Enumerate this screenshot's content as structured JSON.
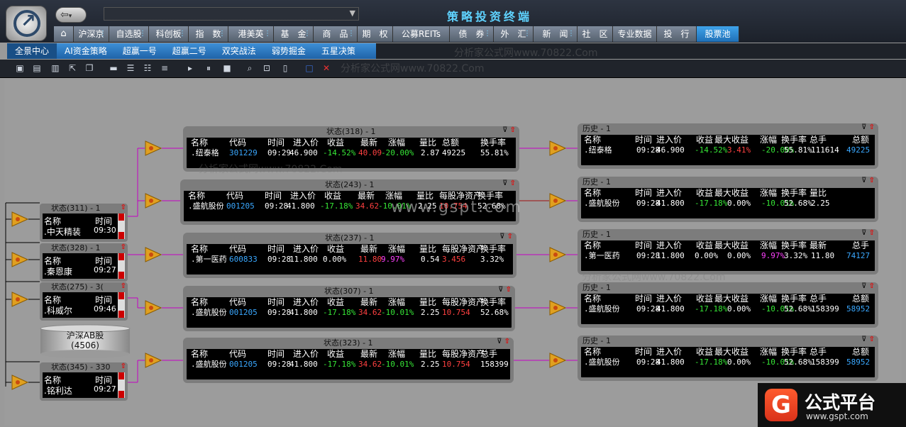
{
  "header": {
    "title": "策略投资终端",
    "address": ""
  },
  "nav": {
    "home_icon": "home-icon",
    "items": [
      {
        "label": "沪深京",
        "more": true
      },
      {
        "label": "自选股",
        "more": true
      },
      {
        "label": "科创板",
        "more": true
      },
      {
        "label": "指　数",
        "more": true
      },
      {
        "label": "港美英",
        "more": true
      },
      {
        "label": "基　金",
        "more": true
      },
      {
        "label": "商　品",
        "more": true
      },
      {
        "label": "期　权",
        "more": false
      },
      {
        "label": "公募REITs",
        "more": false
      },
      {
        "label": "债　券",
        "more": true
      },
      {
        "label": "外　汇",
        "more": true
      },
      {
        "label": "新　闻",
        "more": true
      },
      {
        "label": "社　区",
        "more": false
      },
      {
        "label": "专业数据",
        "more": false
      },
      {
        "label": "投　行",
        "more": false
      },
      {
        "label": "股票池",
        "more": false
      }
    ],
    "more_glyph": "⋮"
  },
  "subnav": {
    "items": [
      "全景中心",
      "AI资金策略",
      "超赢一号",
      "超赢二号",
      "双突战法",
      "弱势掘金",
      "五星决策"
    ]
  },
  "toolbar_icons": [
    "new-folder-icon",
    "open-folder-icon",
    "save-icon",
    "export-icon",
    "window-icon",
    "bar-flat-icon",
    "bar-align-top-icon",
    "bar-align-bottom-icon",
    "bar-color-icon",
    "step-icon",
    "pause-icon",
    "stop-icon",
    "zoom-icon",
    "fit-icon",
    "delete-doc-icon",
    "frame-icon",
    "close-icon"
  ],
  "left_panels": [
    {
      "title": "状态(311) - 1",
      "h1": "名称",
      "h2": "时间",
      "name": ".中天精装",
      "time": "09:30"
    },
    {
      "title": "状态(328) - 1",
      "h1": "名称",
      "h2": "时间",
      "name": ".秦恩康",
      "time": "09:27"
    },
    {
      "title": "状态(275) - 3(",
      "h1": "名称",
      "h2": "时间",
      "name": ".科威尔",
      "time": "09:46"
    },
    {
      "title": "状态(345) - 330",
      "h1": "名称",
      "h2": "时间",
      "name": ".铭利达",
      "time": "09:27"
    }
  ],
  "database": {
    "line1": "沪深AB股",
    "line2": "(4506)"
  },
  "mid_panels": [
    {
      "title": "状态(318) - 1",
      "headers": [
        "名称",
        "代码",
        "时间",
        "进入价",
        "收益",
        "最新",
        "涨幅",
        "量比",
        "总额",
        "换手率"
      ],
      "row": [
        ".纽泰格",
        "301229",
        "09:29",
        "46.900",
        "-14.52%",
        "40.09",
        "-20.00%",
        "2.87",
        "49225",
        "55.81%"
      ]
    },
    {
      "title": "状态(243) - 1",
      "headers": [
        "名称",
        "代码",
        "时间",
        "进入价",
        "收益",
        "最新",
        "涨幅",
        "量比",
        "每股净资产",
        "换手率"
      ],
      "row": [
        ".盛航股份",
        "001205",
        "09:28",
        "41.800",
        "-17.18%",
        "34.62",
        "-10.01%",
        "2.25",
        "10.754",
        "52.68%"
      ]
    },
    {
      "title": "状态(237) - 1",
      "headers": [
        "名称",
        "代码",
        "时间",
        "进入价",
        "收益",
        "最新",
        "涨幅",
        "量比",
        "每股净资产",
        "换手率"
      ],
      "row": [
        ".第一医药",
        "600833",
        "09:28",
        "11.800",
        "0.00%",
        "11.80",
        "9.97%",
        "0.54",
        "3.456",
        "3.32%"
      ]
    },
    {
      "title": "状态(307) - 1",
      "headers": [
        "名称",
        "代码",
        "时间",
        "进入价",
        "收益",
        "最新",
        "涨幅",
        "量比",
        "每股净资产",
        "换手率"
      ],
      "row": [
        ".盛航股份",
        "001205",
        "09:28",
        "41.800",
        "-17.18%",
        "34.62",
        "-10.01%",
        "2.25",
        "10.754",
        "52.68%"
      ]
    },
    {
      "title": "状态(323) - 1",
      "headers": [
        "名称",
        "代码",
        "时间",
        "进入价",
        "收益",
        "最新",
        "涨幅",
        "量比",
        "每股净资产",
        "总手"
      ],
      "row": [
        ".盛航股份",
        "001205",
        "09:28",
        "41.800",
        "-17.18%",
        "34.62",
        "-10.01%",
        "2.25",
        "10.754",
        "158399"
      ]
    }
  ],
  "hist_panels": [
    {
      "title": "历史 - 1",
      "headers": [
        "名称",
        "时间",
        "进入价",
        "收益",
        "最大收益",
        "涨幅",
        "换手率",
        "总手",
        "总额"
      ],
      "row": [
        ".纽泰格",
        "09:28",
        "46.900",
        "-14.52%",
        "3.41%",
        "-20.00%",
        "55.81%",
        "111614",
        "49225"
      ]
    },
    {
      "title": "历史 - 1",
      "headers": [
        "名称",
        "时间",
        "进入价",
        "收益",
        "最大收益",
        "涨幅",
        "换手率",
        "量比"
      ],
      "row": [
        ".盛航股份",
        "09:28",
        "41.800",
        "-17.18%",
        "0.00%",
        "-10.01%",
        "52.68%",
        "2.25"
      ]
    },
    {
      "title": "历史 - 1",
      "headers": [
        "名称",
        "时间",
        "进入价",
        "收益",
        "最大收益",
        "涨幅",
        "换手率",
        "最新",
        "总手"
      ],
      "row": [
        ".第一医药",
        "09:28",
        "11.800",
        "0.00%",
        "0.00%",
        "9.97%",
        "3.32%",
        "11.80",
        "74127"
      ]
    },
    {
      "title": "历史 - 1",
      "headers": [
        "名称",
        "时间",
        "进入价",
        "收益",
        "最大收益",
        "涨幅",
        "换手率",
        "总手",
        "总额"
      ],
      "row": [
        ".盛航股份",
        "09:28",
        "41.800",
        "-17.18%",
        "0.00%",
        "-10.01%",
        "52.68%",
        "158399",
        "58952"
      ]
    },
    {
      "title": "历史 - 1",
      "headers": [
        "名称",
        "时间",
        "进入价",
        "收益",
        "最大收益",
        "涨幅",
        "换手率",
        "总手",
        "总额"
      ],
      "row": [
        ".盛航股份",
        "09:28",
        "41.800",
        "-17.18%",
        "0.00%",
        "-10.01%",
        "52.68%",
        "158399",
        "58952"
      ]
    }
  ],
  "watermarks": {
    "site": "分析家公式网www.70822.Com",
    "center": "www.gspt.com"
  },
  "brand": {
    "name": "公式平台",
    "url": "www.gspt.com",
    "mark": "G"
  },
  "colors": {
    "accent": "#3a8fd6",
    "up": "#ff4040",
    "down": "#36e636",
    "magenta": "#ff40ff",
    "code": "#3aa8ff",
    "title": "#5fd3ff"
  }
}
